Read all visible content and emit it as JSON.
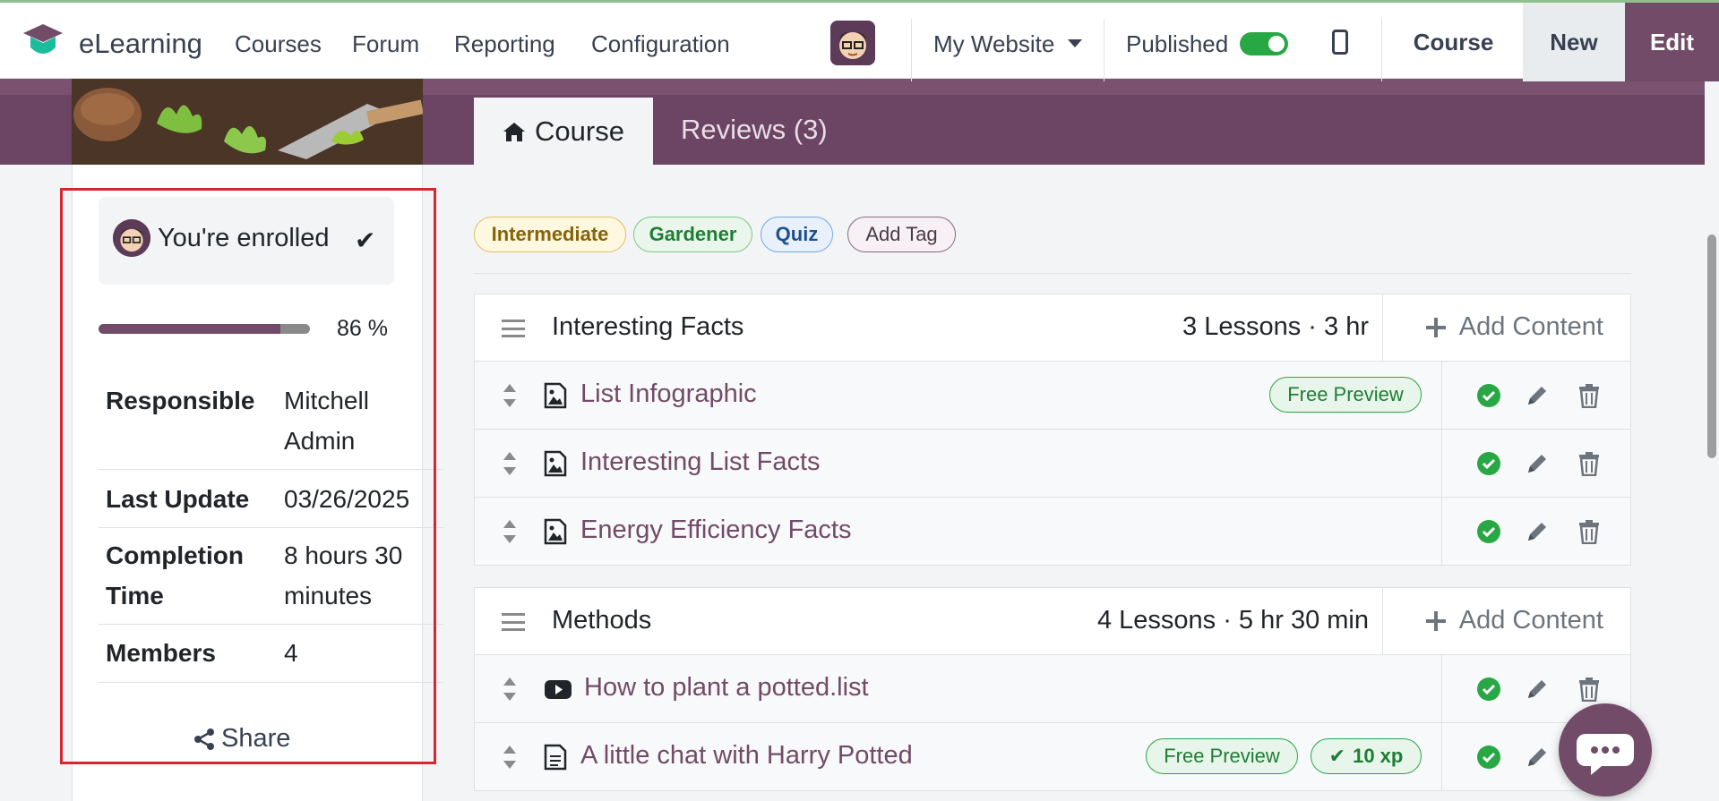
{
  "topbar": {
    "brand": "eLearning",
    "menu": [
      "Courses",
      "Forum",
      "Reporting",
      "Configuration"
    ],
    "website": "My Website",
    "published_label": "Published",
    "published": true,
    "course_button": "Course",
    "new_button": "New",
    "edit_button": "Edit"
  },
  "tabs": {
    "course": "Course",
    "reviews": "Reviews (3)"
  },
  "sidebar": {
    "enrolled_text": "You're enrolled",
    "progress_percent": 86,
    "progress_text": "86 %",
    "details": [
      {
        "label": "Responsible",
        "value": "Mitchell Admin"
      },
      {
        "label": "Last Update",
        "value": "03/26/2025"
      },
      {
        "label": "Completion Time",
        "value": "8 hours 30 minutes"
      },
      {
        "label": "Members",
        "value": "4"
      }
    ],
    "share_label": "Share"
  },
  "tags": [
    {
      "label": "Intermediate",
      "color": "#856404",
      "bg": "#fff8e1",
      "border": "#e0c060"
    },
    {
      "label": "Gardener",
      "color": "#1e7e34",
      "bg": "#eaf6ec",
      "border": "#7cc68a"
    },
    {
      "label": "Quiz",
      "color": "#1d4f91",
      "bg": "#e8f1fb",
      "border": "#7aa7dd"
    },
    {
      "label": "Add Tag",
      "color": "#4b3a45",
      "bg": "#f7f0f5",
      "border": "#8a6a80"
    }
  ],
  "sections": [
    {
      "title": "Interesting Facts",
      "meta": "3 Lessons · 3 hr",
      "add_content": "Add Content",
      "lessons": [
        {
          "title": "List Infographic",
          "type": "image-icon",
          "badges": [
            "Free Preview"
          ]
        },
        {
          "title": "Interesting List Facts",
          "type": "image-icon",
          "badges": []
        },
        {
          "title": "Energy Efficiency Facts",
          "type": "image-icon",
          "badges": []
        }
      ]
    },
    {
      "title": "Methods",
      "meta": "4 Lessons · 5 hr 30 min",
      "add_content": "Add Content",
      "lessons": [
        {
          "title": "How to plant a potted.list",
          "type": "youtube-icon",
          "badges": []
        },
        {
          "title": "A little chat with Harry Potted",
          "type": "document-icon",
          "badges": [
            "Free Preview",
            "10 xp"
          ]
        }
      ]
    }
  ],
  "colors": {
    "brand": "#714b67",
    "success": "#28a745",
    "highlight_border": "#d7262f"
  }
}
